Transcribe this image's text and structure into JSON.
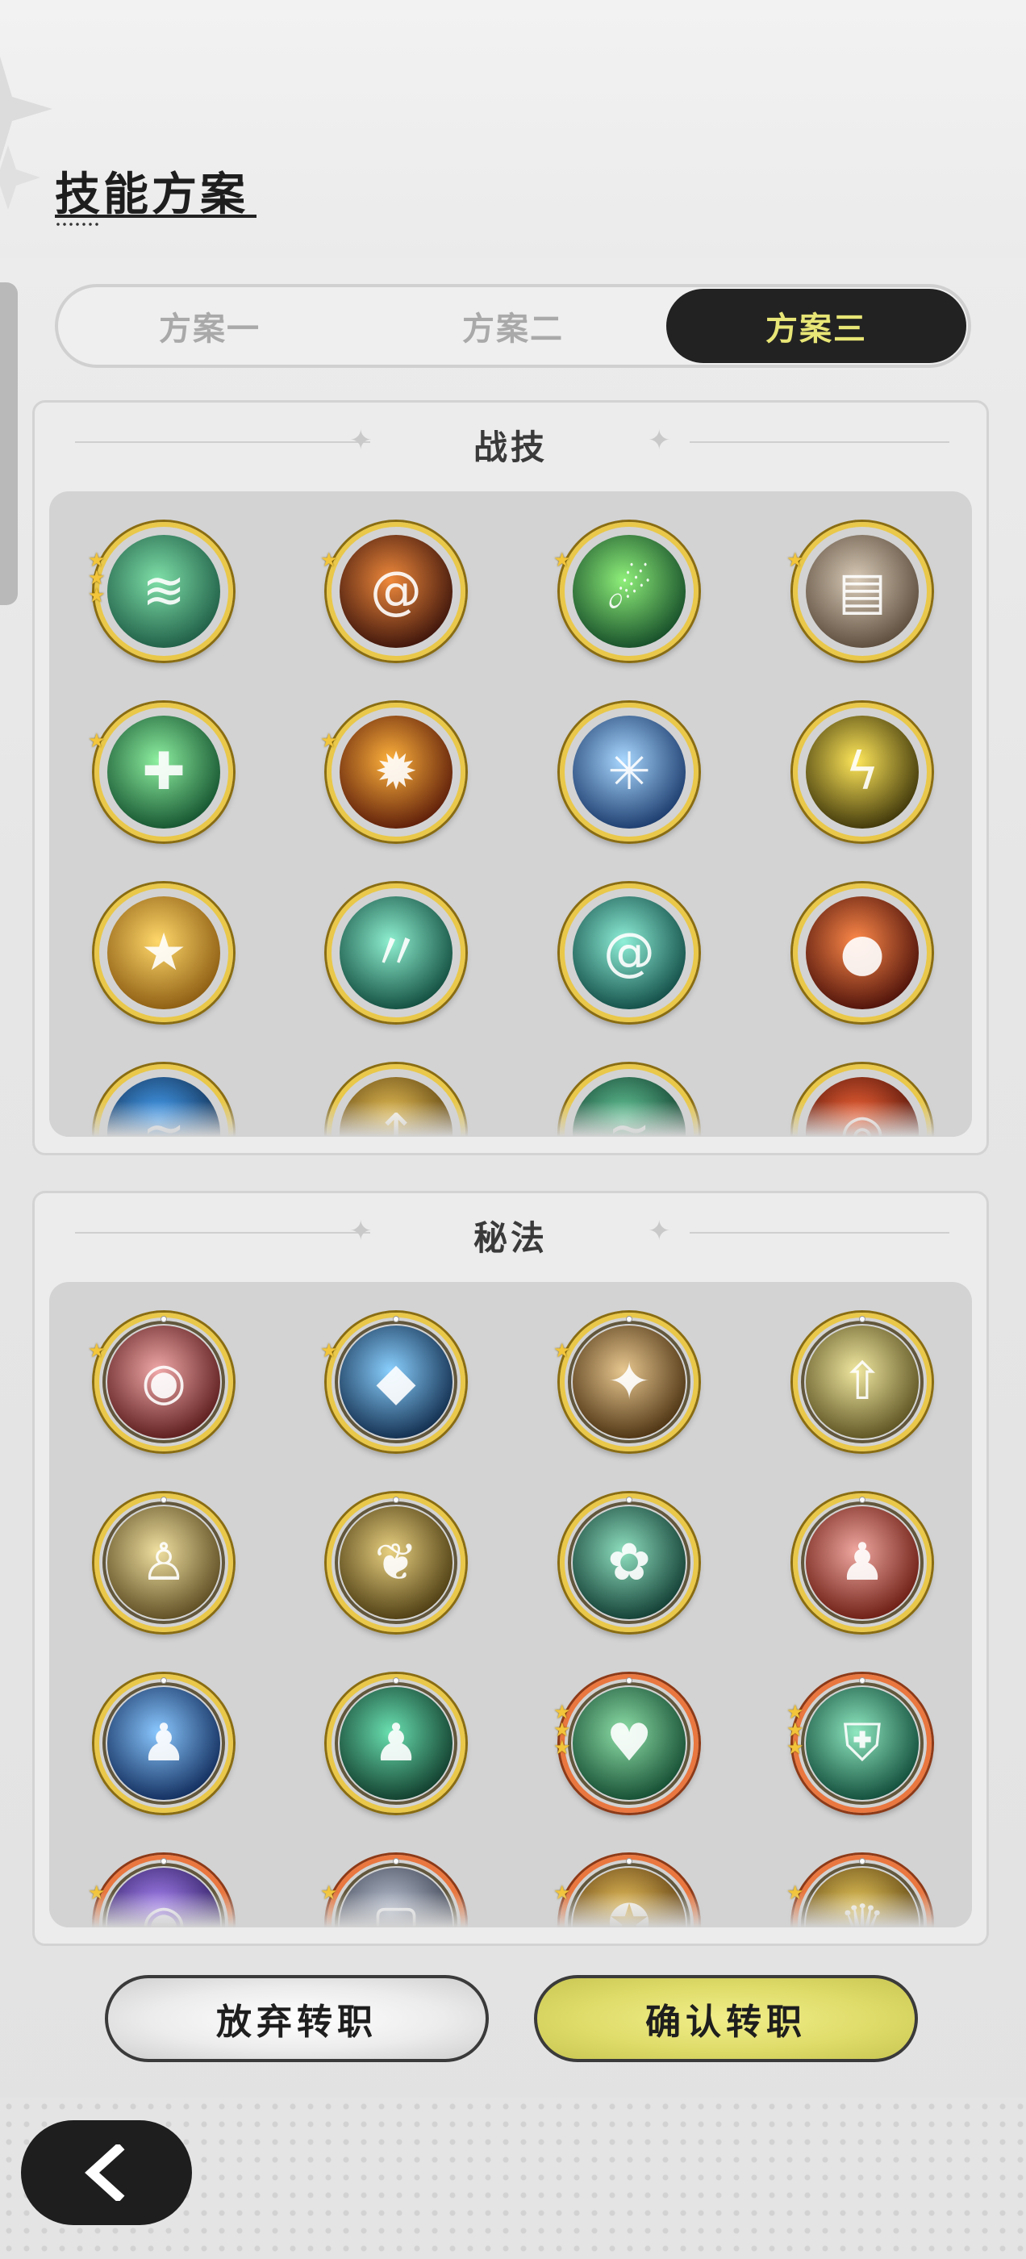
{
  "page": {
    "title": "技能方案"
  },
  "tabs": [
    {
      "label": "方案一",
      "active": false
    },
    {
      "label": "方案二",
      "active": false
    },
    {
      "label": "方案三",
      "active": true
    }
  ],
  "combat_skills": {
    "title": "战技",
    "icons": [
      {
        "name": "wind-orb-icon",
        "stars": 3,
        "frame": "gold",
        "colors": [
          "#7fe0a8",
          "#1d5b45"
        ]
      },
      {
        "name": "fire-vortex-icon",
        "stars": 1,
        "frame": "gold",
        "colors": [
          "#f08a3c",
          "#3a120a"
        ]
      },
      {
        "name": "green-comet-icon",
        "stars": 1,
        "frame": "gold",
        "colors": [
          "#8ff07a",
          "#134a27"
        ]
      },
      {
        "name": "cards-icon",
        "stars": 1,
        "frame": "gold",
        "colors": [
          "#d9cbb8",
          "#5a4a3a"
        ]
      },
      {
        "name": "healing-cross-icon",
        "stars": 1,
        "frame": "gold",
        "colors": [
          "#8ef0a0",
          "#12502d"
        ]
      },
      {
        "name": "flame-burst-icon",
        "stars": 1,
        "frame": "gold",
        "colors": [
          "#ffb23c",
          "#5a1a08"
        ]
      },
      {
        "name": "ice-burst-icon",
        "stars": 0,
        "frame": "gold",
        "colors": [
          "#a9d8ff",
          "#18386a"
        ]
      },
      {
        "name": "lightning-orb-icon",
        "stars": 0,
        "frame": "gold",
        "colors": [
          "#ffe75a",
          "#3a3208"
        ]
      },
      {
        "name": "star-strike-icon",
        "stars": 0,
        "frame": "gold",
        "colors": [
          "#ffd86a",
          "#8a5a10"
        ]
      },
      {
        "name": "wind-blades-icon",
        "stars": 0,
        "frame": "gold",
        "colors": [
          "#8ff0d0",
          "#0f4a3c"
        ]
      },
      {
        "name": "whirlpool-icon",
        "stars": 0,
        "frame": "gold",
        "colors": [
          "#8ff0d8",
          "#0f4a44"
        ]
      },
      {
        "name": "fireball-icon",
        "stars": 0,
        "frame": "gold",
        "colors": [
          "#ff8a4a",
          "#4a0f08"
        ]
      },
      {
        "name": "water-wave-icon",
        "stars": 0,
        "frame": "gold",
        "colors": [
          "#4aa8ff",
          "#0f2a4a"
        ]
      },
      {
        "name": "golden-arrows-icon",
        "stars": 0,
        "frame": "gold",
        "colors": [
          "#f0c85a",
          "#5a4010"
        ]
      },
      {
        "name": "green-beast-icon",
        "stars": 0,
        "frame": "gold",
        "colors": [
          "#6ad0a0",
          "#0f3a2a"
        ]
      },
      {
        "name": "fire-ring-icon",
        "stars": 0,
        "frame": "gold",
        "colors": [
          "#ff6a3a",
          "#4a1008"
        ]
      }
    ]
  },
  "secret_arts": {
    "title": "秘法",
    "icons": [
      {
        "name": "crimson-orb-icon",
        "stars": 1,
        "frame": "gold",
        "colors": [
          "#f0a8a8",
          "#5a1a1a"
        ]
      },
      {
        "name": "blue-crystal-icon",
        "stars": 1,
        "frame": "gold",
        "colors": [
          "#8ad0ff",
          "#0f2a4a"
        ]
      },
      {
        "name": "wand-spark-icon",
        "stars": 1,
        "frame": "gold",
        "colors": [
          "#e8c890",
          "#4a3010"
        ]
      },
      {
        "name": "up-arrow-icon",
        "stars": 0,
        "frame": "gold",
        "colors": [
          "#f0e8a0",
          "#5a5020"
        ]
      },
      {
        "name": "golden-figure-icon",
        "stars": 0,
        "frame": "gold",
        "colors": [
          "#f0e0a0",
          "#5a4a20"
        ]
      },
      {
        "name": "feather-wing-icon",
        "stars": 0,
        "frame": "gold",
        "colors": [
          "#e8d080",
          "#4a3a10"
        ]
      },
      {
        "name": "green-leaf-icon",
        "stars": 0,
        "frame": "gold",
        "colors": [
          "#8fe0c0",
          "#0f3a30"
        ]
      },
      {
        "name": "red-figure-icon",
        "stars": 0,
        "frame": "gold",
        "colors": [
          "#f0a8a0",
          "#6a1a10"
        ]
      },
      {
        "name": "blue-figure-icon",
        "stars": 0,
        "frame": "gold",
        "colors": [
          "#8ac8ff",
          "#0f2a5a"
        ]
      },
      {
        "name": "teal-figure-icon",
        "stars": 0,
        "frame": "gold",
        "colors": [
          "#6ae0b0",
          "#0f3a2a"
        ]
      },
      {
        "name": "green-heart-icon",
        "stars": 3,
        "frame": "orange",
        "colors": [
          "#8fe0a8",
          "#124a30"
        ]
      },
      {
        "name": "armor-chain-icon",
        "stars": 3,
        "frame": "orange",
        "colors": [
          "#8fe8c0",
          "#0f4a38"
        ]
      },
      {
        "name": "purple-orb-icon",
        "stars": 1,
        "frame": "orange",
        "colors": [
          "#b08aff",
          "#2a1a5a"
        ]
      },
      {
        "name": "silver-scroll-icon",
        "stars": 1,
        "frame": "orange",
        "colors": [
          "#c0c8d8",
          "#3a4050"
        ]
      },
      {
        "name": "gold-emblem-icon",
        "stars": 1,
        "frame": "orange",
        "colors": [
          "#f0c860",
          "#5a3a10"
        ]
      },
      {
        "name": "gold-crown-icon",
        "stars": 1,
        "frame": "orange",
        "colors": [
          "#f0d060",
          "#5a4010"
        ]
      }
    ]
  },
  "actions": {
    "abandon_label": "放弃转职",
    "confirm_label": "确认转职"
  },
  "nav": {
    "back_icon": "chevron-left-icon"
  },
  "colors": {
    "accent_yellow": "#e8e676",
    "dark": "#222222",
    "gold_frame": "#e9c84a",
    "orange_frame": "#e9773f"
  }
}
